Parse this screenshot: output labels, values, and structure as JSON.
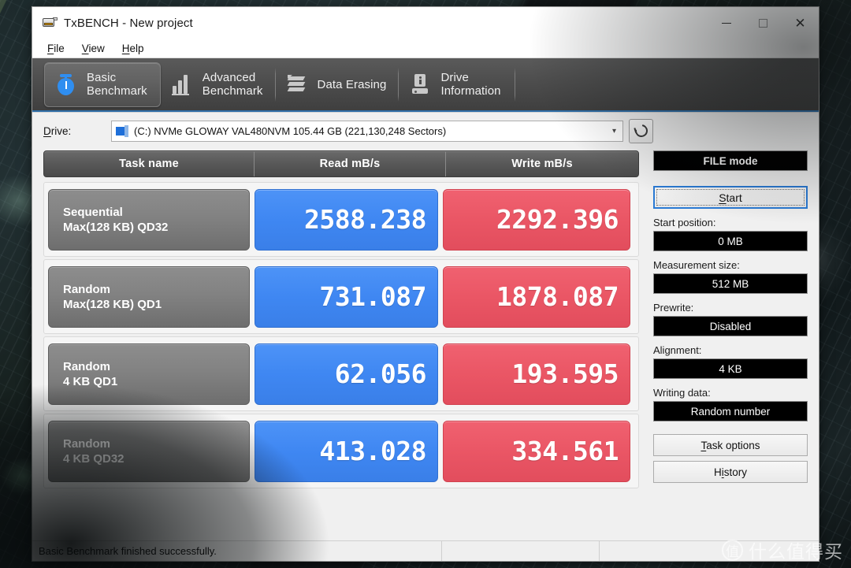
{
  "window": {
    "title": "TxBENCH - New project",
    "app_icon": "drive-app-icon",
    "controls": {
      "minimize": "minimize-icon",
      "maximize": "maximize-icon",
      "close": "close-icon"
    }
  },
  "menu": {
    "items": [
      {
        "label": "File",
        "accel": "F"
      },
      {
        "label": "View",
        "accel": "V"
      },
      {
        "label": "Help",
        "accel": "H"
      }
    ]
  },
  "tabs": [
    {
      "label": "Basic\nBenchmark",
      "icon": "stopwatch-icon",
      "active": true
    },
    {
      "label": "Advanced\nBenchmark",
      "icon": "bar-chart-icon",
      "active": false
    },
    {
      "label": "Data Erasing",
      "icon": "erase-icon",
      "active": false
    },
    {
      "label": "Drive\nInformation",
      "icon": "drive-info-icon",
      "active": false
    }
  ],
  "drive": {
    "label": "Drive:",
    "label_accel": "D",
    "selected": "(C:) NVMe GLOWAY VAL480NVM  105.44 GB (221,130,248 Sectors)",
    "dropdown_arrow": "chevron-down-icon",
    "refresh_icon": "refresh-icon"
  },
  "table": {
    "headers": [
      "Task name",
      "Read mB/s",
      "Write mB/s"
    ],
    "rows": [
      {
        "task_line1": "Sequential",
        "task_line2": "Max(128 KB) QD32",
        "read": "2588.238",
        "write": "2292.396"
      },
      {
        "task_line1": "Random",
        "task_line2": "Max(128 KB) QD1",
        "read": "731.087",
        "write": "1878.087"
      },
      {
        "task_line1": "Random",
        "task_line2": "4 KB QD1",
        "read": "62.056",
        "write": "193.595"
      },
      {
        "task_line1": "Random",
        "task_line2": "4 KB QD32",
        "read": "413.028",
        "write": "334.561"
      }
    ]
  },
  "sidebar": {
    "mode_label": "FILE mode",
    "start_label": "Start",
    "start_accel": "S",
    "fields": [
      {
        "caption": "Start position:",
        "value": "0 MB"
      },
      {
        "caption": "Measurement size:",
        "value": "512 MB"
      },
      {
        "caption": "Prewrite:",
        "value": "Disabled"
      },
      {
        "caption": "Alignment:",
        "value": "4 KB"
      },
      {
        "caption": "Writing data:",
        "value": "Random number"
      }
    ],
    "task_options_label": "Task options",
    "task_options_accel": "T",
    "history_label": "History",
    "history_accel": "i"
  },
  "statusbar": {
    "message": "Basic Benchmark finished successfully.",
    "segment2": "",
    "segment3": ""
  },
  "watermark": {
    "mark": "值",
    "text": "什么值得买"
  },
  "colors": {
    "read_blue": "#3f87f2",
    "write_red": "#ea5665",
    "tabstrip": "#4e4e4e",
    "accent_focus": "#2a7ad4",
    "field_bg": "#000000"
  }
}
